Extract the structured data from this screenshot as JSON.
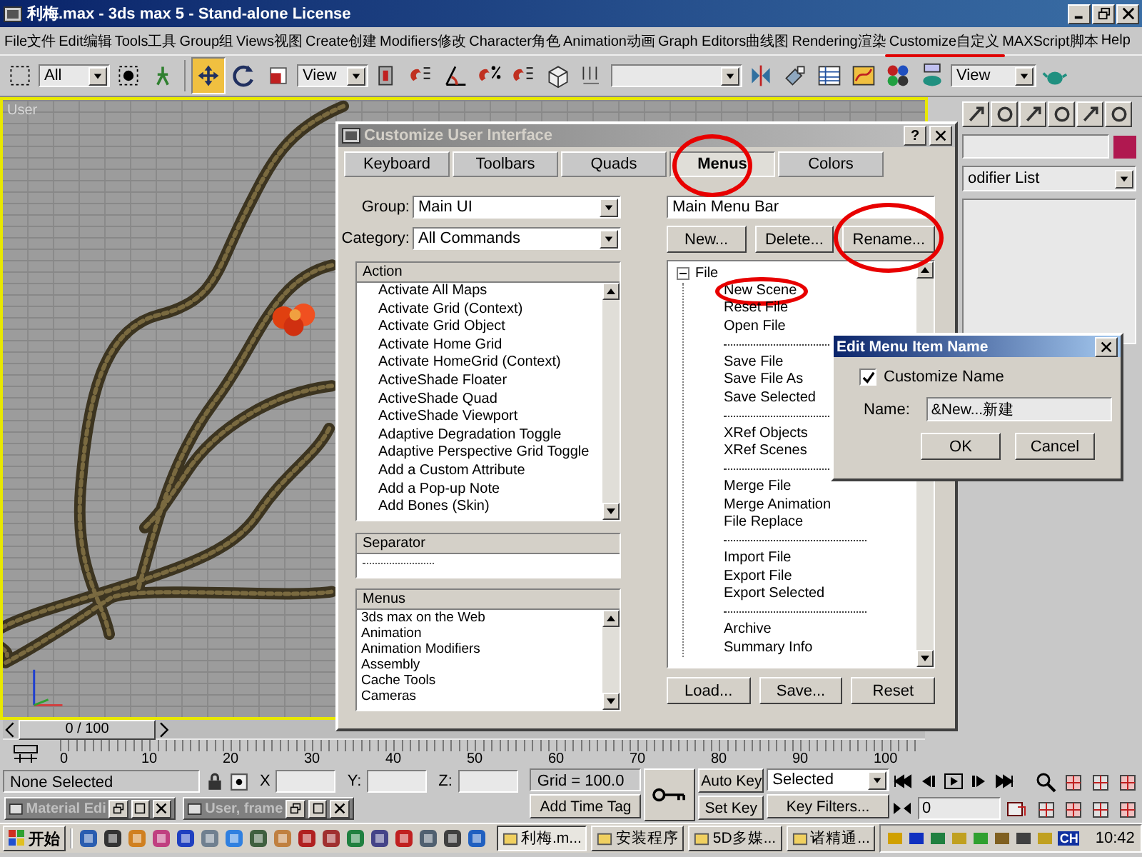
{
  "window": {
    "title": "利梅.max - 3ds max 5 - Stand-alone License"
  },
  "menu_bar": [
    {
      "label": "File文件",
      "marked": false
    },
    {
      "label": "Edit编辑",
      "marked": false
    },
    {
      "label": "Tools工具",
      "marked": false
    },
    {
      "label": "Group组",
      "marked": false
    },
    {
      "label": "Views视图",
      "marked": false
    },
    {
      "label": "Create创建",
      "marked": false
    },
    {
      "label": "Modifiers修改",
      "marked": false
    },
    {
      "label": "Character角色",
      "marked": false
    },
    {
      "label": "Animation动画",
      "marked": false
    },
    {
      "label": "Graph Editors曲线图",
      "marked": false
    },
    {
      "label": "Rendering渲染",
      "marked": false
    },
    {
      "label": "Customize自定义",
      "marked": true
    },
    {
      "label": "MAXScript脚本",
      "marked": false
    },
    {
      "label": "Help",
      "marked": false
    }
  ],
  "toolbar": {
    "selection_filter": "All",
    "coordinate_system": "View",
    "render_type": "View",
    "tools": [
      {
        "kind": "move",
        "selected": true
      },
      {
        "kind": "rotate",
        "selected": false
      },
      {
        "kind": "scale",
        "selected": false
      }
    ]
  },
  "viewport": {
    "label": "User"
  },
  "command_panel": {
    "modifier_list": "odifier List"
  },
  "time_slider": {
    "label": "0 / 100"
  },
  "ruler": {
    "labels": [
      "0",
      "10",
      "20",
      "30",
      "40",
      "50",
      "60",
      "70",
      "80",
      "90",
      "100"
    ]
  },
  "status": {
    "selection": "None Selected",
    "x_label": "X",
    "y_label": "Y:",
    "z_label": "Z:",
    "grid": "Grid = 100.0",
    "time_tag": "Add Time Tag",
    "auto_key": "Auto Key",
    "set_key": "Set Key",
    "key_set": "Selected",
    "key_filters": "Key Filters...",
    "frame": "0"
  },
  "minimized_windows": [
    {
      "title": "Material Edi"
    },
    {
      "title": "User, frame"
    }
  ],
  "cui": {
    "title": "Customize User Interface",
    "help_button": "?",
    "tabs": [
      {
        "label": "Keyboard",
        "selected": false,
        "marked": false
      },
      {
        "label": "Toolbars",
        "selected": false,
        "marked": false
      },
      {
        "label": "Quads",
        "selected": false,
        "marked": false
      },
      {
        "label": "Menus",
        "selected": true,
        "marked": true
      },
      {
        "label": "Colors",
        "selected": false,
        "marked": false
      }
    ],
    "group_label": "Group:",
    "group": "Main UI",
    "category_label": "Category:",
    "category": "All Commands",
    "action_header": "Action",
    "actions": [
      "Activate All Maps",
      "Activate Grid (Context)",
      "Activate Grid Object",
      "Activate Home Grid",
      "Activate HomeGrid (Context)",
      "ActiveShade Floater",
      "ActiveShade Quad",
      "ActiveShade Viewport",
      "Adaptive Degradation Toggle",
      "Adaptive Perspective Grid Toggle",
      "Add a Custom Attribute",
      "Add a Pop-up Note",
      "Add Bones (Skin)"
    ],
    "separator_header": "Separator",
    "menus_header": "Menus",
    "menus": [
      "3ds max on the Web",
      "Animation",
      "Animation Modifiers",
      "Assembly",
      "Cache Tools",
      "Cameras"
    ],
    "menu_set": "Main Menu Bar",
    "menu_buttons": [
      {
        "label": "New...",
        "marked": false
      },
      {
        "label": "Delete...",
        "marked": false
      },
      {
        "label": "Rename...",
        "marked": true
      }
    ],
    "tree": [
      {
        "label": "File",
        "expanded": true,
        "children": [
          {
            "kind": "item",
            "label": "New Scene",
            "marked": true
          },
          {
            "kind": "item",
            "label": "Reset File",
            "marked": false
          },
          {
            "kind": "item",
            "label": "Open File",
            "marked": false
          },
          {
            "kind": "separator"
          },
          {
            "kind": "item",
            "label": "Save File",
            "marked": false
          },
          {
            "kind": "item",
            "label": "Save File As",
            "marked": false
          },
          {
            "kind": "item",
            "label": "Save Selected",
            "marked": false
          },
          {
            "kind": "separator"
          },
          {
            "kind": "item",
            "label": "XRef Objects",
            "marked": false
          },
          {
            "kind": "item",
            "label": "XRef Scenes",
            "marked": false
          },
          {
            "kind": "separator"
          },
          {
            "kind": "item",
            "label": "Merge File",
            "marked": false
          },
          {
            "kind": "item",
            "label": "Merge Animation",
            "marked": false
          },
          {
            "kind": "item",
            "label": "File Replace",
            "marked": false
          },
          {
            "kind": "separator"
          },
          {
            "kind": "item",
            "label": "Import File",
            "marked": false
          },
          {
            "kind": "item",
            "label": "Export File",
            "marked": false
          },
          {
            "kind": "item",
            "label": "Export Selected",
            "marked": false
          },
          {
            "kind": "separator"
          },
          {
            "kind": "item",
            "label": "Archive",
            "marked": false
          },
          {
            "kind": "item",
            "label": "Summary Info",
            "marked": false
          }
        ]
      }
    ],
    "file_buttons": [
      "Load...",
      "Save...",
      "Reset"
    ]
  },
  "edit_dialog": {
    "title": "Edit Menu Item Name",
    "customize_label": "Customize Name",
    "customize_checked": true,
    "name_label": "Name:",
    "name_value": "&New...新建",
    "buttons": [
      "OK",
      "Cancel"
    ]
  },
  "taskbar": {
    "start": "开始",
    "tasks": [
      {
        "label": "利梅.m...",
        "selected": true
      },
      {
        "label": "安装程序",
        "selected": false
      },
      {
        "label": "5D多媒...",
        "selected": false
      },
      {
        "label": "诸精通...",
        "selected": false
      }
    ],
    "language": "CH",
    "clock": "10:42"
  }
}
